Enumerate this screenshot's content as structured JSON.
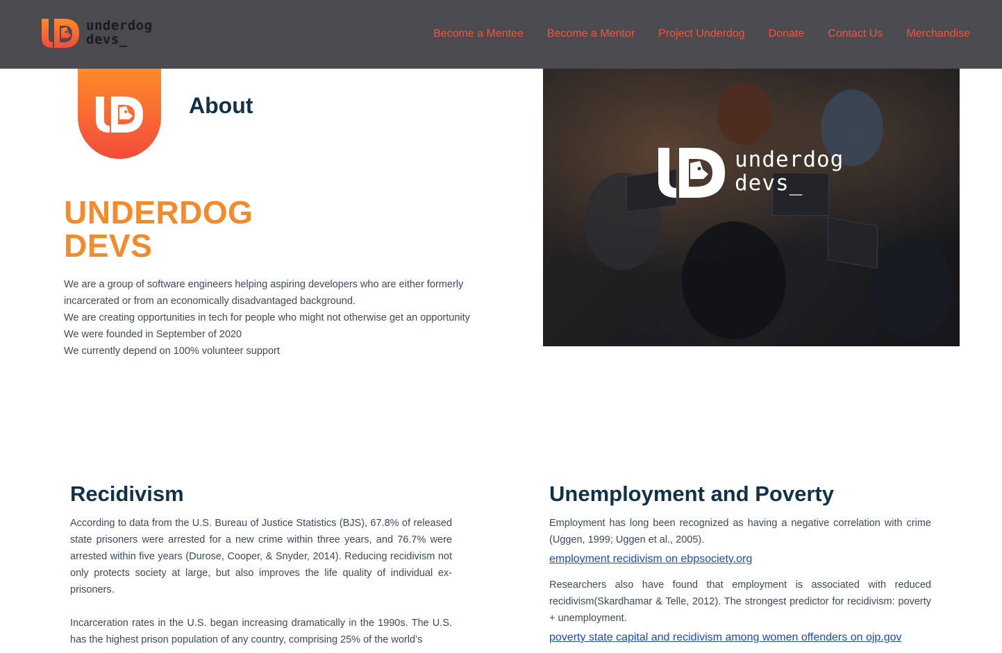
{
  "header": {
    "logo": {
      "line1": "underdog",
      "line2": "devs_"
    },
    "nav": [
      "Become a Mentee",
      "Become a Mentor",
      "Project Underdog",
      "Donate",
      "Contact Us",
      "Merchandise"
    ]
  },
  "about": {
    "title": "About",
    "brand_line1": "UNDERDOG",
    "brand_line2": "DEVS",
    "intro": [
      "We are a group of software engineers helping aspiring developers who are either formerly incarcerated or from an economically disadvantaged background.",
      "We are creating opportunities in tech for people who might not otherwise get an opportunity",
      "We were founded in September of 2020",
      "We currently depend on 100% volunteer support"
    ],
    "hero_logo": {
      "line1": "underdog",
      "line2": "devs_"
    }
  },
  "recidivism": {
    "title": "Recidivism",
    "p1": "According to data from the U.S. Bureau of Justice Statistics (BJS), 67.8% of released state prisoners were arrested for a new crime within three years, and 76.7% were arrested within five years (Durose, Cooper, & Snyder, 2014). Reducing recidivism not only protects society at large, but also improves the life quality of individual ex-prisoners.",
    "p2": "Incarceration rates in the U.S. began increasing dramatically in the 1990s. The U.S. has the highest prison population of any country, comprising 25% of the world’s"
  },
  "unemployment": {
    "title": "Unemployment and Poverty",
    "p1": "Employment has long been recognized as having a negative correlation with crime (Uggen, 1999; Uggen et al., 2005).",
    "link1": "employment recidivism on ebpsociety.org",
    "p2": "Researchers also have found that employment is associated with reduced recidivism(Skardhamar & Telle, 2012). The strongest predictor for recidivism: poverty + unemployment.",
    "link2": "poverty state capital and recidivism among women offenders on ojp.gov"
  },
  "colors": {
    "header_bg": "#4a4a4f",
    "nav_link": "#f2553f",
    "brand_orange": "#f58a2b",
    "heading_navy": "#10314a",
    "link_blue": "#1a49c7"
  }
}
